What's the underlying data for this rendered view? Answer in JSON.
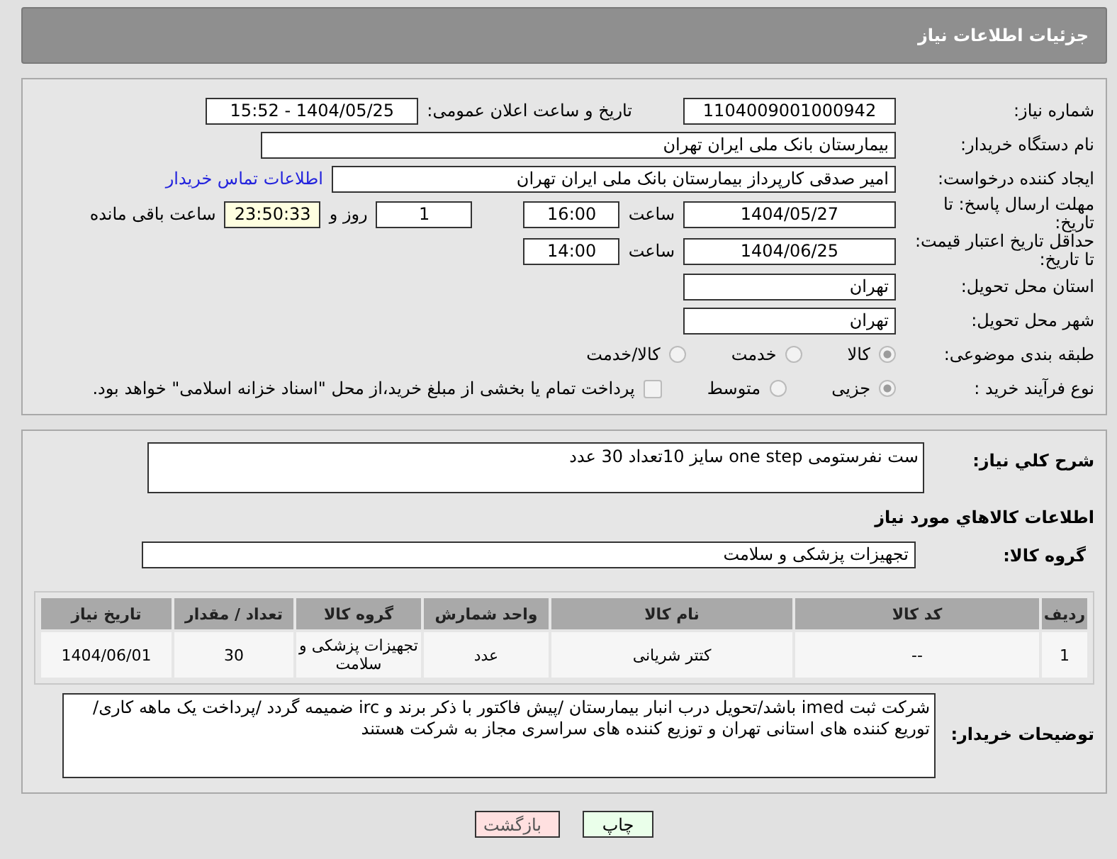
{
  "header": {
    "title": "جزئیات اطلاعات نیاز"
  },
  "form": {
    "rows": [
      {
        "label": "شماره نیاز:",
        "items": [
          {
            "kind": "field",
            "value": "1104009001000942"
          },
          {
            "kind": "text",
            "text": "تاریخ و ساعت اعلان عمومی:"
          },
          {
            "kind": "field",
            "value": "1404/05/25 - 15:52"
          }
        ]
      },
      {
        "label": "نام دستگاه خریدار:",
        "items": [
          {
            "kind": "field",
            "value": "بیمارستان بانک ملی ایران تهران"
          }
        ]
      },
      {
        "label": "ایجاد کننده درخواست:",
        "items": [
          {
            "kind": "field",
            "value": "امیر صدقی کارپرداز بیمارستان بانک ملی ایران تهران"
          },
          {
            "kind": "link",
            "text": "اطلاعات تماس خریدار"
          }
        ]
      },
      {
        "label": "مهلت ارسال پاسخ: تا تاریخ:",
        "items": [
          {
            "kind": "field",
            "value": "1404/05/27"
          },
          {
            "kind": "text",
            "text": "ساعت"
          },
          {
            "kind": "field",
            "value": "16:00"
          },
          {
            "kind": "field",
            "value": "1"
          },
          {
            "kind": "text",
            "text": "روز و"
          },
          {
            "kind": "timer",
            "value": "23:50:33"
          },
          {
            "kind": "text",
            "text": "ساعت باقی مانده"
          }
        ]
      },
      {
        "label": "حداقل تاریخ اعتبار قیمت: تا تاریخ:",
        "items": [
          {
            "kind": "field",
            "value": "1404/06/25"
          },
          {
            "kind": "text",
            "text": "ساعت"
          },
          {
            "kind": "field",
            "value": "14:00"
          }
        ]
      },
      {
        "label": "استان محل تحویل:",
        "items": [
          {
            "kind": "field",
            "value": "تهران"
          }
        ]
      },
      {
        "label": "شهر محل تحویل:",
        "items": [
          {
            "kind": "field",
            "value": "تهران"
          }
        ]
      },
      {
        "label": "طبقه بندی موضوعی:",
        "items": [
          {
            "kind": "radio",
            "text": "کالا",
            "selected": true
          },
          {
            "kind": "radio",
            "text": "خدمت",
            "selected": false
          },
          {
            "kind": "radio",
            "text": "کالا/خدمت",
            "selected": false
          }
        ]
      },
      {
        "label": "نوع فرآیند خرید :",
        "items": [
          {
            "kind": "radio",
            "text": "جزیی",
            "selected": true
          },
          {
            "kind": "radio",
            "text": "متوسط",
            "selected": false
          },
          {
            "kind": "checkbox",
            "text": "پرداخت تمام یا بخشی از مبلغ خرید،از محل \"اسناد خزانه اسلامی\" خواهد بود.",
            "checked": false
          }
        ]
      }
    ]
  },
  "description": {
    "label": "شرح کلي نياز:",
    "value": "ست نفرستومی one step سایز 10تعداد 30 عدد"
  },
  "goods_heading": "اطلاعات کالاهاي مورد نياز",
  "goods_group": {
    "label": "گروه کالا:",
    "value": "تجهیزات پزشکی و سلامت"
  },
  "table": {
    "columns": [
      "ردیف",
      "کد کالا",
      "نام کالا",
      "واحد شمارش",
      "گروه کالا",
      "تعداد / مقدار",
      "تاریخ نیاز"
    ],
    "rows": [
      [
        "1",
        "--",
        "کتتر شریانی",
        "عدد",
        "تجهیزات پزشکی و سلامت",
        "30",
        "1404/06/01"
      ]
    ]
  },
  "buyer_notes": {
    "label": "توضیحات خریدار:",
    "value": "شرکت ثبت imed باشد/تحویل درب انبار بیمارستان /پیش فاکتور با ذکر برند و irc ضمیمه گردد /پرداخت یک ماهه کاری/ توریع کننده های استانی تهران و توزیع کننده های سراسری مجاز به شرکت هستند"
  },
  "buttons": [
    {
      "kind": "print",
      "label": "چاپ"
    },
    {
      "kind": "back",
      "label": "بازگشت"
    }
  ]
}
